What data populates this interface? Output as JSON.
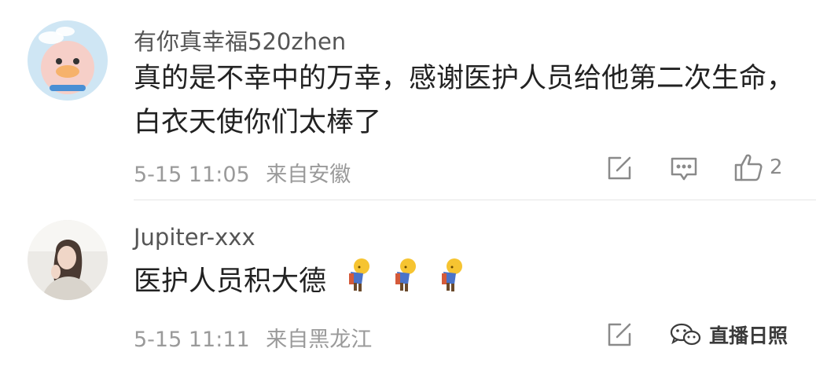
{
  "comments": [
    {
      "username": "有你真幸福520zhen",
      "text": "真的是不幸中的万幸，感谢医护人员给他第二次生命，白衣天使你们太棒了",
      "date": "5-15 11:05",
      "location": "来自安徽",
      "like_count": "2",
      "avatar_icon": "pink-duck-avatar"
    },
    {
      "username": "Jupiter-xxx",
      "text": "医护人员积大德",
      "date": "5-15 11:11",
      "location": "来自黑龙江",
      "avatar_icon": "woman-photo-avatar",
      "emoji_icon": "bowing-emoji"
    }
  ],
  "watermark": {
    "text": "直播日照",
    "icon": "wechat-icon"
  },
  "colors": {
    "text": "#222222",
    "username": "#555555",
    "meta": "#9a9a9a",
    "divider": "#e6e6e6"
  }
}
